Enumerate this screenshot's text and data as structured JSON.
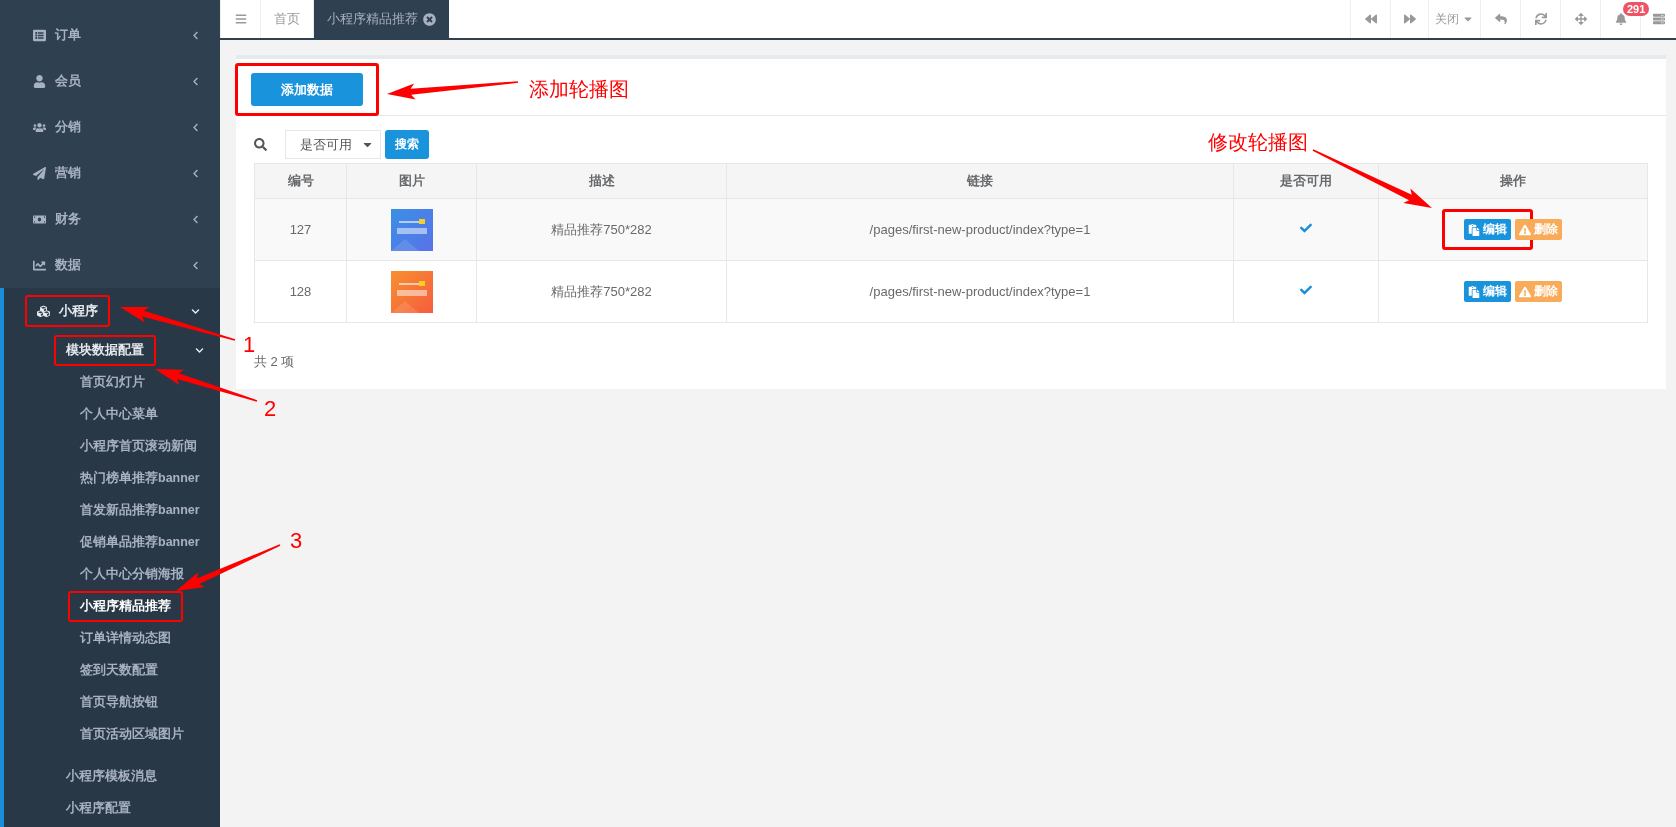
{
  "sidebar": {
    "items": [
      {
        "label": "订单",
        "expanded": false,
        "selected": false,
        "highlighted": false
      },
      {
        "label": "会员",
        "expanded": false,
        "selected": false,
        "highlighted": false
      },
      {
        "label": "分销",
        "expanded": false,
        "selected": false,
        "highlighted": false
      },
      {
        "label": "营销",
        "expanded": false,
        "selected": false,
        "highlighted": false
      },
      {
        "label": "财务",
        "expanded": false,
        "selected": false,
        "highlighted": false
      },
      {
        "label": "数据",
        "expanded": false,
        "selected": false,
        "highlighted": false
      },
      {
        "label": "小程序",
        "expanded": true,
        "selected": false,
        "highlighted": true,
        "children": [
          {
            "label": "模块数据配置",
            "expanded": true,
            "selected": false,
            "highlighted": true,
            "children": [
              {
                "label": "首页幻灯片",
                "selected": false,
                "highlighted": false
              },
              {
                "label": "个人中心菜单",
                "selected": false,
                "highlighted": false
              },
              {
                "label": "小程序首页滚动新闻",
                "selected": false,
                "highlighted": false
              },
              {
                "label": "热门榜单推荐banner",
                "selected": false,
                "highlighted": false
              },
              {
                "label": "首发新品推荐banner",
                "selected": false,
                "highlighted": false
              },
              {
                "label": "促销单品推荐banner",
                "selected": false,
                "highlighted": false
              },
              {
                "label": "个人中心分销海报",
                "selected": false,
                "highlighted": false
              },
              {
                "label": "小程序精品推荐",
                "selected": true,
                "highlighted": true
              },
              {
                "label": "订单详情动态图",
                "selected": false,
                "highlighted": false
              },
              {
                "label": "签到天数配置",
                "selected": false,
                "highlighted": false
              },
              {
                "label": "首页导航按钮",
                "selected": false,
                "highlighted": false
              },
              {
                "label": "首页活动区域图片",
                "selected": false,
                "highlighted": false
              }
            ]
          },
          {
            "label": "小程序模板消息",
            "selected": false,
            "highlighted": false
          },
          {
            "label": "小程序配置",
            "selected": false,
            "highlighted": false
          }
        ]
      }
    ]
  },
  "tabs": [
    {
      "label": "首页",
      "selected": false,
      "closable": false
    },
    {
      "label": "小程序精品推荐",
      "selected": true,
      "closable": true
    }
  ],
  "toolbar": {
    "close_menu": "关闭",
    "notifications": "291"
  },
  "panel": {
    "add_button": {
      "label": "添加数据",
      "highlighted": true
    },
    "filter": {
      "select_value": "是否可用",
      "search_button": "搜索"
    },
    "table": {
      "columns": [
        "编号",
        "图片",
        "描述",
        "链接",
        "是否可用",
        "操作"
      ],
      "rows": [
        {
          "id": "127",
          "description": "精品推荐750*282",
          "link": "/pages/first-new-product/index?type=1",
          "enabled": true,
          "actions": [
            {
              "kind": "edit",
              "label": "编辑",
              "highlighted": true
            },
            {
              "kind": "delete",
              "label": "删除",
              "highlighted": false
            }
          ]
        },
        {
          "id": "128",
          "description": "精品推荐750*282",
          "link": "/pages/first-new-product/index?type=1",
          "enabled": true,
          "actions": [
            {
              "kind": "edit",
              "label": "编辑",
              "highlighted": false
            },
            {
              "kind": "delete",
              "label": "删除",
              "highlighted": false
            }
          ]
        }
      ]
    },
    "footer": "共 2 项"
  },
  "annotations": [
    {
      "text": "添加轮播图"
    },
    {
      "text": "修改轮播图"
    },
    {
      "text": "1"
    },
    {
      "text": "2"
    },
    {
      "text": "3"
    }
  ]
}
